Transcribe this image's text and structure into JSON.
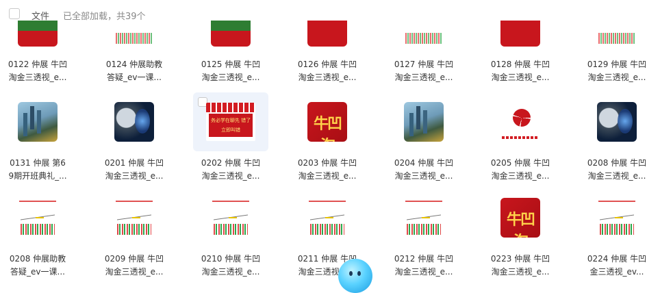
{
  "header": {
    "column_label": "文件",
    "status": "已全部加载，共39个"
  },
  "tiles": [
    {
      "line1": "0122 仲展 牛凹",
      "line2": "淘金三透视_e...",
      "thumb": "cut-green",
      "row": 0,
      "col": 0
    },
    {
      "line1": "0124 仲展助教",
      "line2": "答疑_ev一课...",
      "thumb": "cut-chart",
      "row": 0,
      "col": 1
    },
    {
      "line1": "0125 仲展 牛凹",
      "line2": "淘金三透视_e...",
      "thumb": "cut-green",
      "row": 0,
      "col": 2
    },
    {
      "line1": "0126 仲展 牛凹",
      "line2": "淘金三透视_e...",
      "thumb": "cut-red",
      "row": 0,
      "col": 3
    },
    {
      "line1": "0127 仲展 牛凹",
      "line2": "淘金三透视_e...",
      "thumb": "cut-chart",
      "row": 0,
      "col": 4
    },
    {
      "line1": "0128 仲展 牛凹",
      "line2": "淘金三透视_e...",
      "thumb": "cut-red",
      "row": 0,
      "col": 5
    },
    {
      "line1": "0129 仲展 牛凹",
      "line2": "淘金三透视_e...",
      "thumb": "cut-chart",
      "row": 0,
      "col": 6
    },
    {
      "line1": "0131 仲展 第6",
      "line2": "9期开班典礼_...",
      "thumb": "city",
      "row": 1,
      "col": 0
    },
    {
      "line1": "0201 仲展 牛凹",
      "line2": "淘金三透视_e...",
      "thumb": "robot",
      "row": 1,
      "col": 1
    },
    {
      "line1": "0202 仲展 牛凹",
      "line2": "淘金三透视_e...",
      "thumb": "banner",
      "row": 1,
      "col": 2,
      "selected": true,
      "banner_text": "务必学在聊先 错了立即叫错"
    },
    {
      "line1": "0203 仲展 牛凹",
      "line2": "淘金三透视_e...",
      "thumb": "red",
      "row": 1,
      "col": 3,
      "glyph": "牛凹淘"
    },
    {
      "line1": "0204 仲展 牛凹",
      "line2": "淘金三透视_e...",
      "thumb": "city",
      "row": 1,
      "col": 4
    },
    {
      "line1": "0205 仲展 牛凹",
      "line2": "淘金三透视_e...",
      "thumb": "pie",
      "row": 1,
      "col": 5
    },
    {
      "line1": "0208 仲展 牛凹",
      "line2": "淘金三透视_e...",
      "thumb": "robot",
      "row": 1,
      "col": 6
    },
    {
      "line1": "0208 仲展助教",
      "line2": "答疑_ev一课...",
      "thumb": "chart",
      "row": 2,
      "col": 0
    },
    {
      "line1": "0209 仲展 牛凹",
      "line2": "淘金三透视_e...",
      "thumb": "chart",
      "row": 2,
      "col": 1
    },
    {
      "line1": "0210 仲展 牛凹",
      "line2": "淘金三透视_e...",
      "thumb": "chart",
      "row": 2,
      "col": 2
    },
    {
      "line1": "0211 仲展 牛凹",
      "line2": "淘金三透视_e...",
      "thumb": "chart",
      "row": 2,
      "col": 3
    },
    {
      "line1": "0212 仲展 牛凹",
      "line2": "淘金三透视_e...",
      "thumb": "chart",
      "row": 2,
      "col": 4
    },
    {
      "line1": "0223 仲展 牛凹",
      "line2": "淘金三透视_e...",
      "thumb": "red",
      "row": 2,
      "col": 5,
      "glyph": "牛凹淘"
    },
    {
      "line1": "0224 仲展 牛凹",
      "line2": "金三透视_ev...",
      "thumb": "chart",
      "row": 2,
      "col": 6
    }
  ]
}
